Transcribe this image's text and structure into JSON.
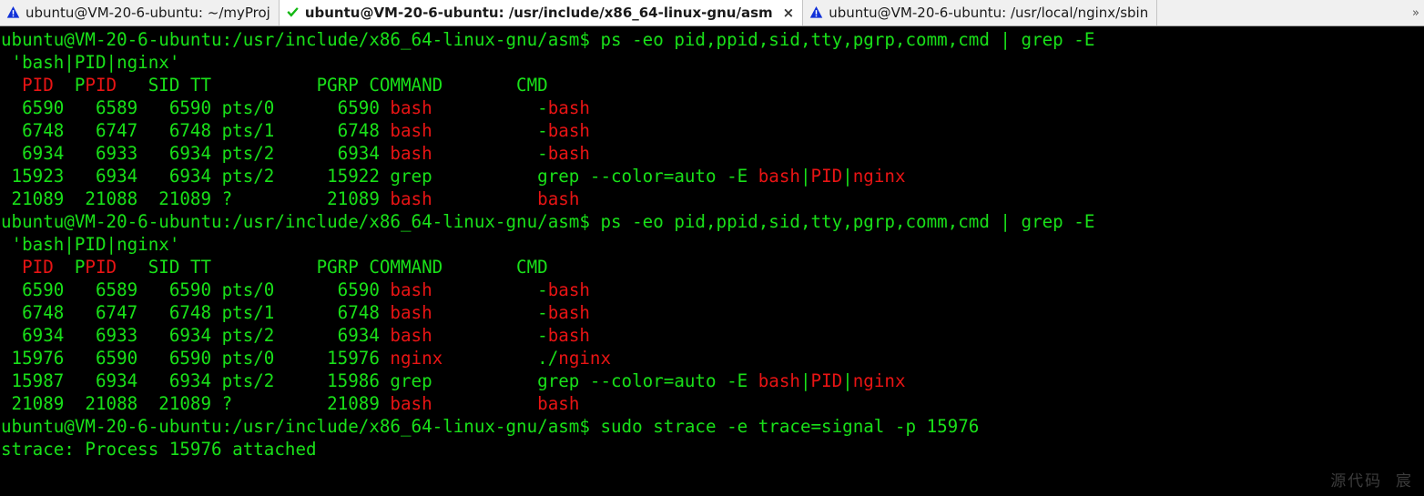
{
  "window": {
    "title": "ubuntu@VM-20-6-ubuntu: /usr/include/x86_64-linux-gnu/asm",
    "bg_color": "#000000",
    "fg_color": "#19e019",
    "highlight_color": "#e81414",
    "tabbar_bg": "#f0f0f0"
  },
  "tabbar": {
    "scroll_right_glyph": "»",
    "tabs": [
      {
        "icon": "warning-triangle-icon",
        "label": "ubuntu@VM-20-6-ubuntu: ~/myProj",
        "active": false,
        "closable": false,
        "close_glyph": "×"
      },
      {
        "icon": "check-mark-icon",
        "label": "ubuntu@VM-20-6-ubuntu: /usr/include/x86_64-linux-gnu/asm",
        "active": true,
        "closable": true,
        "close_glyph": "×"
      },
      {
        "icon": "warning-triangle-icon",
        "label": "ubuntu@VM-20-6-ubuntu: /usr/local/nginx/sbin",
        "active": false,
        "closable": false,
        "close_glyph": "×"
      }
    ]
  },
  "terminal": {
    "prompt": "ubuntu@VM-20-6-ubuntu:/usr/include/x86_64-linux-gnu/asm$ ",
    "lines": [
      {
        "id": "cmd-1",
        "segments": [
          {
            "text": "ubuntu@VM-20-6-ubuntu:/usr/include/x86_64-linux-gnu/asm$ ps -eo pid,ppid,sid,tty,pgrp,comm,cmd | grep -E",
            "color": "green"
          }
        ]
      },
      {
        "id": "cmd-1-wrap",
        "segments": [
          {
            "text": " 'bash|PID|nginx'",
            "color": "green"
          }
        ]
      },
      {
        "id": "header-1",
        "segments": [
          {
            "text": "  ",
            "color": "green"
          },
          {
            "text": "PID",
            "color": "red"
          },
          {
            "text": "  P",
            "color": "green"
          },
          {
            "text": "PID",
            "color": "red"
          },
          {
            "text": "   SID TT          PGRP COMMAND       CMD",
            "color": "green"
          }
        ]
      },
      {
        "id": "row-1-1",
        "segments": [
          {
            "text": "  6590   6589   6590 pts/0      6590 ",
            "color": "green"
          },
          {
            "text": "bash",
            "color": "red"
          },
          {
            "text": "          -",
            "color": "green"
          },
          {
            "text": "bash",
            "color": "red"
          }
        ]
      },
      {
        "id": "row-1-2",
        "segments": [
          {
            "text": "  6748   6747   6748 pts/1      6748 ",
            "color": "green"
          },
          {
            "text": "bash",
            "color": "red"
          },
          {
            "text": "          -",
            "color": "green"
          },
          {
            "text": "bash",
            "color": "red"
          }
        ]
      },
      {
        "id": "row-1-3",
        "segments": [
          {
            "text": "  6934   6933   6934 pts/2      6934 ",
            "color": "green"
          },
          {
            "text": "bash",
            "color": "red"
          },
          {
            "text": "          -",
            "color": "green"
          },
          {
            "text": "bash",
            "color": "red"
          }
        ]
      },
      {
        "id": "row-1-4",
        "segments": [
          {
            "text": " 15923   6934   6934 pts/2     15922 grep          grep --color=auto -E ",
            "color": "green"
          },
          {
            "text": "bash",
            "color": "red"
          },
          {
            "text": "|",
            "color": "green"
          },
          {
            "text": "PID",
            "color": "red"
          },
          {
            "text": "|",
            "color": "green"
          },
          {
            "text": "nginx",
            "color": "red"
          }
        ]
      },
      {
        "id": "row-1-5",
        "segments": [
          {
            "text": " 21089  21088  21089 ?         21089 ",
            "color": "green"
          },
          {
            "text": "bash",
            "color": "red"
          },
          {
            "text": "          ",
            "color": "green"
          },
          {
            "text": "bash",
            "color": "red"
          }
        ]
      },
      {
        "id": "cmd-2",
        "segments": [
          {
            "text": "ubuntu@VM-20-6-ubuntu:/usr/include/x86_64-linux-gnu/asm$ ps -eo pid,ppid,sid,tty,pgrp,comm,cmd | grep -E",
            "color": "green"
          }
        ]
      },
      {
        "id": "cmd-2-wrap",
        "segments": [
          {
            "text": " 'bash|PID|nginx'",
            "color": "green"
          }
        ]
      },
      {
        "id": "header-2",
        "segments": [
          {
            "text": "  ",
            "color": "green"
          },
          {
            "text": "PID",
            "color": "red"
          },
          {
            "text": "  P",
            "color": "green"
          },
          {
            "text": "PID",
            "color": "red"
          },
          {
            "text": "   SID TT          PGRP COMMAND       CMD",
            "color": "green"
          }
        ]
      },
      {
        "id": "row-2-1",
        "segments": [
          {
            "text": "  6590   6589   6590 pts/0      6590 ",
            "color": "green"
          },
          {
            "text": "bash",
            "color": "red"
          },
          {
            "text": "          -",
            "color": "green"
          },
          {
            "text": "bash",
            "color": "red"
          }
        ]
      },
      {
        "id": "row-2-2",
        "segments": [
          {
            "text": "  6748   6747   6748 pts/1      6748 ",
            "color": "green"
          },
          {
            "text": "bash",
            "color": "red"
          },
          {
            "text": "          -",
            "color": "green"
          },
          {
            "text": "bash",
            "color": "red"
          }
        ]
      },
      {
        "id": "row-2-3",
        "segments": [
          {
            "text": "  6934   6933   6934 pts/2      6934 ",
            "color": "green"
          },
          {
            "text": "bash",
            "color": "red"
          },
          {
            "text": "          -",
            "color": "green"
          },
          {
            "text": "bash",
            "color": "red"
          }
        ]
      },
      {
        "id": "row-2-4",
        "segments": [
          {
            "text": " 15976   6590   6590 pts/0     15976 ",
            "color": "green"
          },
          {
            "text": "nginx",
            "color": "red"
          },
          {
            "text": "         ./",
            "color": "green"
          },
          {
            "text": "nginx",
            "color": "red"
          }
        ]
      },
      {
        "id": "row-2-5",
        "segments": [
          {
            "text": " 15987   6934   6934 pts/2     15986 grep          grep --color=auto -E ",
            "color": "green"
          },
          {
            "text": "bash",
            "color": "red"
          },
          {
            "text": "|",
            "color": "green"
          },
          {
            "text": "PID",
            "color": "red"
          },
          {
            "text": "|",
            "color": "green"
          },
          {
            "text": "nginx",
            "color": "red"
          }
        ]
      },
      {
        "id": "row-2-6",
        "segments": [
          {
            "text": " 21089  21088  21089 ?         21089 ",
            "color": "green"
          },
          {
            "text": "bash",
            "color": "red"
          },
          {
            "text": "          ",
            "color": "green"
          },
          {
            "text": "bash",
            "color": "red"
          }
        ]
      },
      {
        "id": "cmd-3",
        "segments": [
          {
            "text": "ubuntu@VM-20-6-ubuntu:/usr/include/x86_64-linux-gnu/asm$ sudo strace -e trace=signal -p 15976",
            "color": "green"
          }
        ]
      },
      {
        "id": "out-3",
        "segments": [
          {
            "text": "strace: Process 15976 attached",
            "color": "green"
          }
        ]
      }
    ]
  },
  "watermark": {
    "text": "源代码  宸"
  }
}
